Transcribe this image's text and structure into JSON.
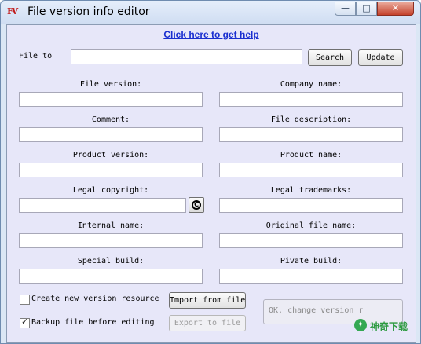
{
  "window": {
    "icon_text": "FV",
    "title": "File version info editor",
    "min_glyph": "—",
    "max_glyph": "□",
    "close_glyph": "✕"
  },
  "help_link": "Click here to get help",
  "file_to_edit": {
    "label": "File to edit:",
    "value": "",
    "search_label": "Search",
    "update_label": "Update"
  },
  "fields": {
    "file_version": {
      "label": "File version:",
      "value": ""
    },
    "company_name": {
      "label": "Company name:",
      "value": ""
    },
    "comment": {
      "label": "Comment:",
      "value": ""
    },
    "file_description": {
      "label": "File description:",
      "value": ""
    },
    "product_version": {
      "label": "Product version:",
      "value": ""
    },
    "product_name": {
      "label": "Product name:",
      "value": ""
    },
    "legal_copyright": {
      "label": "Legal copyright:",
      "value": ""
    },
    "legal_trademarks": {
      "label": "Legal trademarks:",
      "value": ""
    },
    "internal_name": {
      "label": "Internal name:",
      "value": ""
    },
    "original_file_name": {
      "label": "Original file name:",
      "value": ""
    },
    "special_build": {
      "label": "Special build:",
      "value": ""
    },
    "private_build": {
      "label": "Pivate build:",
      "value": ""
    }
  },
  "copyright_button": "C",
  "options": {
    "create_resource": {
      "label": "Create new version resource",
      "checked": false
    },
    "backup_file": {
      "label": "Backup file before editing",
      "checked": true,
      "tick": "✓"
    }
  },
  "buttons": {
    "import": "Import from file",
    "export": "Export to file",
    "ok": "OK, change version r"
  },
  "watermark": {
    "icon": "✦",
    "text": "神奇下载"
  }
}
